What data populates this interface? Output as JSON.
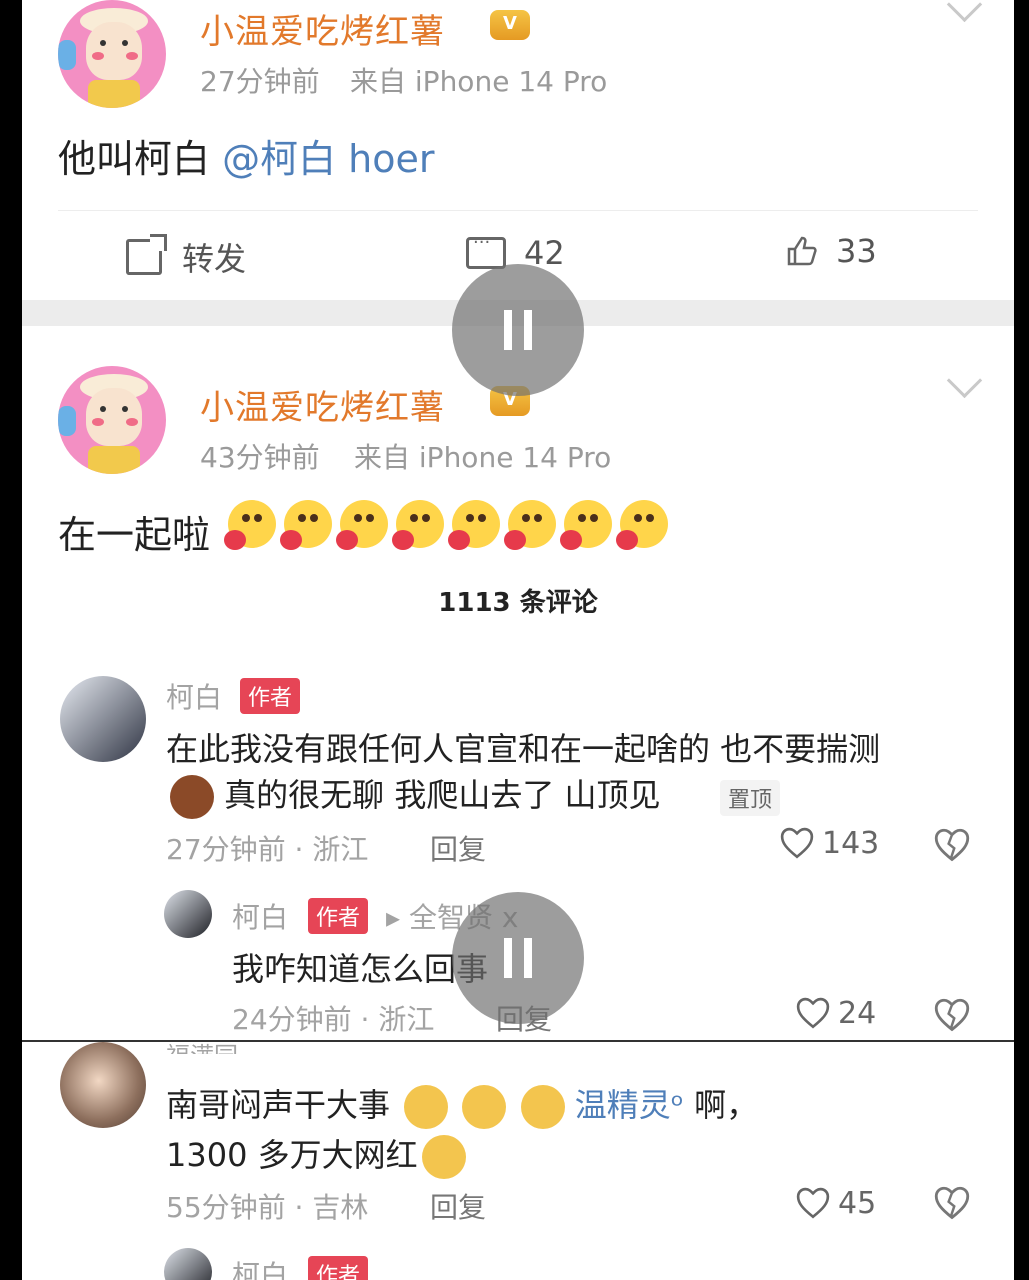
{
  "posts": [
    {
      "user": "小温爱吃烤红薯",
      "time": "27分钟前",
      "source": "来自 iPhone 14 Pro",
      "text_main": "他叫柯白 ",
      "mention": "@柯白 hoer",
      "actions": {
        "share": "转发",
        "comments": "42",
        "likes": "33"
      }
    },
    {
      "user": "小温爱吃烤红薯",
      "time": "43分钟前",
      "source": "来自 iPhone 14 Pro",
      "text": "在一起啦"
    }
  ],
  "comments": {
    "header": "1113 条评论",
    "items": [
      {
        "user": "柯白",
        "tag": "作者",
        "text_line1": "在此我没有跟任何人官宣和在一起啥的 也不要揣测",
        "text_line2": "真的很无聊 我爬山去了 山顶见",
        "pin": "置顶",
        "time": "27分钟前 · 浙江",
        "reply": "回复",
        "likes": "143"
      },
      {
        "user": "柯白",
        "tag": "作者",
        "reply_to": "▸ 全智贤 x",
        "text": "我咋知道怎么回事",
        "time": "24分钟前 · 浙江",
        "reply": "回复",
        "likes": "24"
      },
      {
        "user": "福满园",
        "text_before_link": "南哥闷声干大事",
        "link": "温精灵",
        "text_after_link": "啊，",
        "text_line2": "1300 多万大网红",
        "time": "55分钟前 · 吉林",
        "reply": "回复",
        "likes": "45"
      },
      {
        "user": "柯白",
        "tag": "作者"
      }
    ]
  },
  "colors": {
    "accent": "#e2792b",
    "link": "#4f7fb9",
    "author_tag": "#e64556"
  }
}
